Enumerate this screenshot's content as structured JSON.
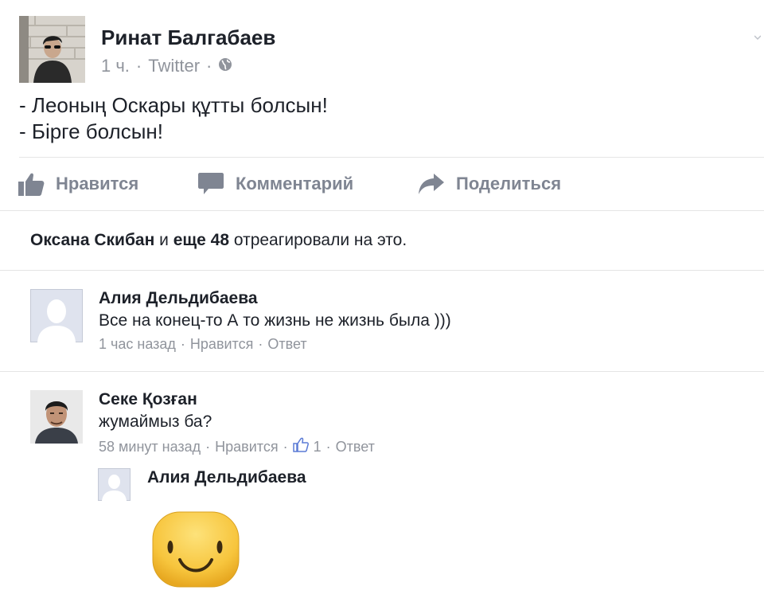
{
  "post": {
    "author": "Ринат Балгабаев",
    "time": "1 ч.",
    "source": "Twitter",
    "separator": "·",
    "lines": [
      "- Леоның Оскары құтты болсын!",
      "- Бірге болсын!"
    ]
  },
  "actions": {
    "like": "Нравится",
    "comment": "Комментарий",
    "share": "Поделиться"
  },
  "reactions": {
    "name": "Оксана Скибан",
    "and": "и",
    "more": "еще 48",
    "suffix": "отреагировали на это."
  },
  "comments": [
    {
      "author": "Алия Дельдибаева",
      "text": "Все на конец-то А то жизнь не жизнь была )))",
      "time": "1 час назад",
      "like": "Нравится",
      "reply": "Ответ"
    },
    {
      "author": "Секе Қозған",
      "text": "жумаймыз ба?",
      "time": "58 минут назад",
      "like": "Нравится",
      "like_count": "1",
      "reply": "Ответ"
    }
  ],
  "reply": {
    "author": "Алия Дельдибаева"
  },
  "colors": {
    "text": "#1d2129",
    "meta": "#90949c",
    "action": "#7f8592",
    "divider": "#e5e5e5",
    "sticker": "#f9c94a"
  }
}
